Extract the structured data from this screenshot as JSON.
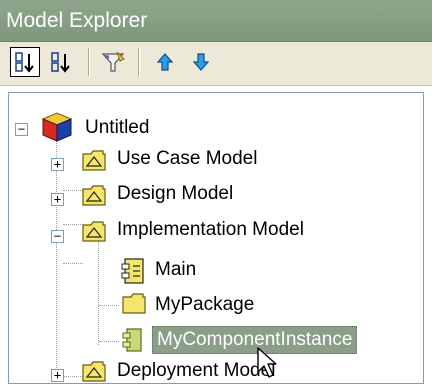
{
  "window": {
    "title": "Model Explorer"
  },
  "toolbar": {
    "buttons": [
      {
        "icon": "sort-ordered-icon"
      },
      {
        "icon": "sort-alphabetical-icon"
      },
      {
        "icon": "filter-icon"
      },
      {
        "icon": "move-up-icon"
      },
      {
        "icon": "move-down-icon"
      }
    ]
  },
  "tree": {
    "root": {
      "label": "Untitled"
    },
    "items": [
      {
        "label": "Use Case Model"
      },
      {
        "label": "Design Model"
      },
      {
        "label": "Implementation Model"
      },
      {
        "label": "Main"
      },
      {
        "label": "MyPackage"
      },
      {
        "label": "MyComponentInstance"
      },
      {
        "label": "Deployment Model"
      }
    ]
  },
  "colors": {
    "titlebar": "#8fa68c",
    "selection": "#8a9e88",
    "package_folder": "#f5e66b"
  }
}
